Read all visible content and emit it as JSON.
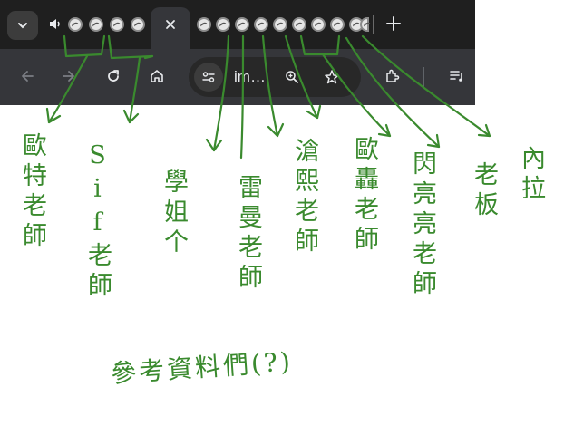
{
  "browser": {
    "active_tab_close": "×",
    "new_tab": "+",
    "omnibox": {
      "url_text": "im…"
    },
    "icons": [
      "chevron-down-icon",
      "speaker-icon",
      "favicon",
      "close-icon",
      "plus-icon",
      "back-icon",
      "forward-icon",
      "reload-icon",
      "home-icon",
      "site-info-icon",
      "zoom-icon",
      "star-icon",
      "extensions-icon",
      "reading-list-icon"
    ],
    "colors": {
      "frame": "#1f1f1f",
      "toolbar": "#35363a",
      "ink": "#3a8a2e"
    }
  },
  "annotations": {
    "labels": [
      {
        "text": "歐特老師"
      },
      {
        "text": "Sif老師"
      },
      {
        "text": "學姐个"
      },
      {
        "text": "雷曼老師"
      },
      {
        "text": "滄熙老師"
      },
      {
        "text": "歐轟老師"
      },
      {
        "text": "閃亮亮老師"
      },
      {
        "text": "老板"
      },
      {
        "text": "內拉"
      }
    ],
    "caption": "參考資料們(?)"
  }
}
